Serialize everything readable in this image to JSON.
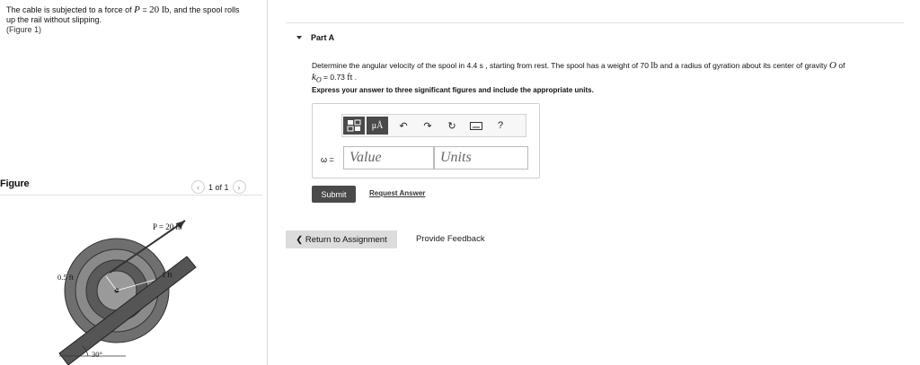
{
  "problem": {
    "text_before": "The cable is subjected to a force of ",
    "math_var": "P",
    "text_eq": " = ",
    "math_val": "20 lb",
    "text_after": ", and the spool rolls up the rail without slipping.",
    "figure_link": "(Figure 1)"
  },
  "figure": {
    "heading": "Figure",
    "pager_text": "1 of 1",
    "prev_icon": "chevron-left-icon",
    "next_icon": "chevron-right-icon",
    "label_force": "P = 20 lb",
    "label_inner": "0.5 ft",
    "label_outer": "1 ft",
    "label_angle": "30°"
  },
  "part": {
    "title": "Part A",
    "question_before": "Determine the angular velocity of the spool in 4.4 s , starting from rest. The spool has a weight of 70 ",
    "question_unit": "lb",
    "question_mid": " and a radius of gyration about its center of gravity ",
    "question_sym": "O",
    "question_end": " of",
    "k_sym": "k",
    "k_sub": "O",
    "k_val": " = 0.73 ",
    "k_unit": "ft",
    "k_period": " .",
    "instruction": "Express your answer to three significant figures and include the appropriate units."
  },
  "answer": {
    "label": "ω =",
    "value_placeholder": "Value",
    "units_placeholder": "Units",
    "toolbar": [
      "templates-icon",
      "units-icon",
      "undo-icon",
      "redo-icon",
      "reset-icon",
      "keyboard-icon",
      "help-icon"
    ],
    "units_button_text": "μÅ",
    "help_text": "?"
  },
  "actions": {
    "submit": "Submit",
    "request_answer": "Request Answer",
    "return": "❮ Return to Assignment",
    "feedback": "Provide Feedback"
  },
  "colors": {
    "button_dark": "#4a4a4a",
    "return_bg": "#dcdcdc"
  }
}
